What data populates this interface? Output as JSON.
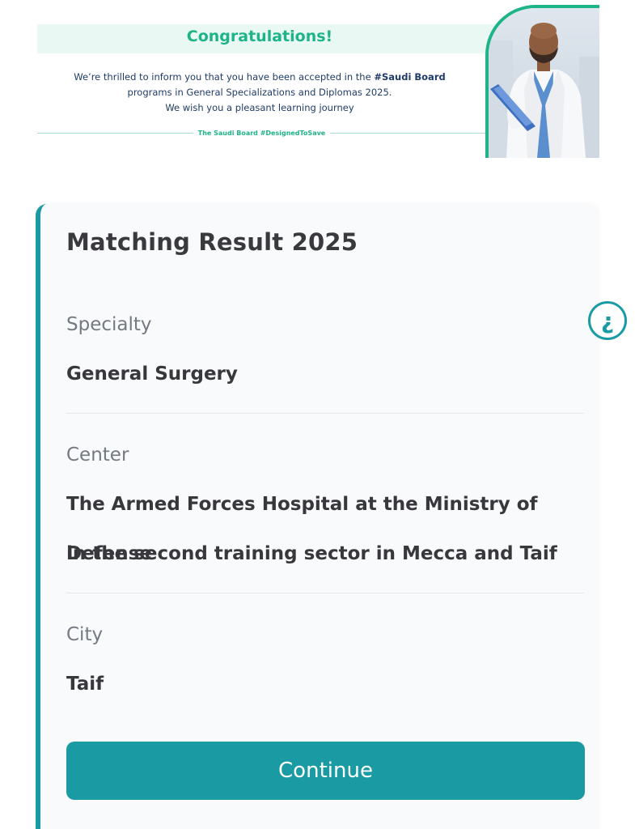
{
  "banner": {
    "title": "Congratulations!",
    "message_line1_prefix": "We’re thrilled to inform you that you have been accepted in the ",
    "message_line1_bold": "#Saudi Board",
    "message_line2": "programs in General Specializations and Diplomas 2025.",
    "message_line3": "We wish you a pleasant learning journey",
    "tagline": "The Saudi Board #DesignedToSave",
    "accent_color": "#1db487"
  },
  "card": {
    "title": "Matching Result 2025",
    "fields": [
      {
        "label": "Specialty",
        "value": "General Surgery"
      },
      {
        "label": "Center",
        "value_line1": "The Armed Forces Hospital at the Ministry of Defense",
        "value_line2": "in the second training sector in Mecca and Taif"
      },
      {
        "label": "City",
        "value": "Taif"
      }
    ],
    "continue_label": "Continue",
    "accent_color": "#1a9ba3"
  },
  "help": {
    "icon": "¿"
  }
}
